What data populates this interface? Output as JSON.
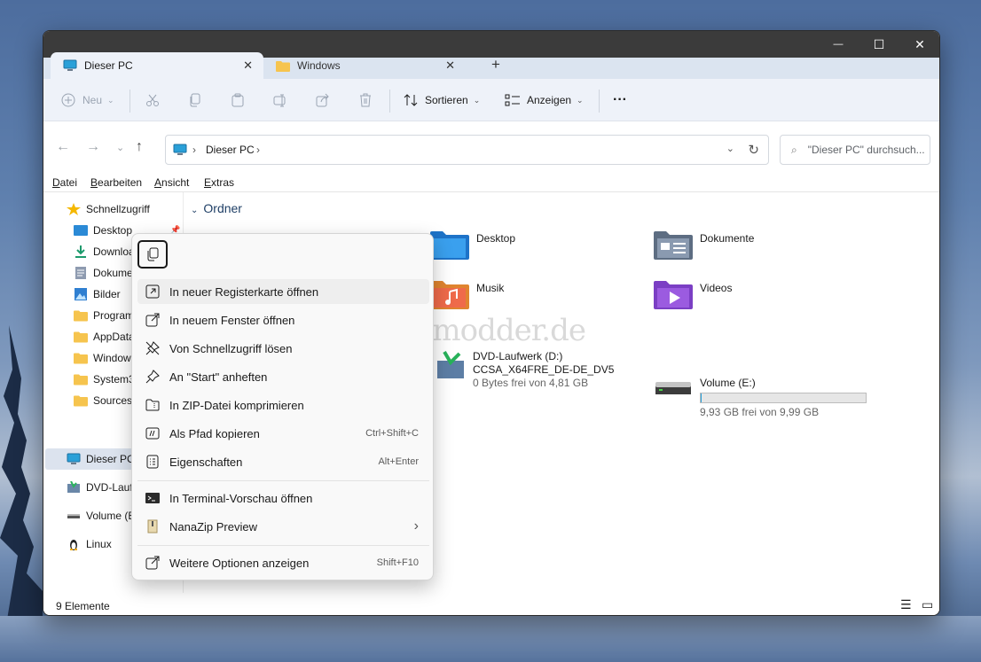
{
  "window": {
    "tabs": [
      {
        "label": "Dieser PC",
        "close": "✕"
      },
      {
        "label": "Windows",
        "close": "✕"
      }
    ],
    "new_tab": "+",
    "caption": {
      "minimize": "—",
      "maximize": "☐",
      "close": "✕"
    }
  },
  "toolbar": {
    "new_label": "Neu",
    "sort_label": "Sortieren",
    "view_label": "Anzeigen",
    "more_label": "···"
  },
  "navbar": {
    "breadcrumb": "Dieser PC",
    "search_placeholder": "\"Dieser PC\" durchsuch..."
  },
  "menubar": {
    "items": [
      {
        "accel": "D",
        "rest": "atei"
      },
      {
        "accel": "B",
        "rest": "earbeiten"
      },
      {
        "accel": "A",
        "rest": "nsicht"
      },
      {
        "accel": "E",
        "rest": "xtras"
      }
    ]
  },
  "sidebar": {
    "items": [
      {
        "label": "Schnellzugriff",
        "icon": "star-icon"
      },
      {
        "label": "Desktop",
        "icon": "desktop-folder-icon"
      },
      {
        "label": "Downloa",
        "icon": "download-icon"
      },
      {
        "label": "Dokume",
        "icon": "documents-icon"
      },
      {
        "label": "Bilder",
        "icon": "pictures-icon"
      },
      {
        "label": "Program",
        "icon": "folder-icon"
      },
      {
        "label": "AppData",
        "icon": "folder-icon"
      },
      {
        "label": "Window",
        "icon": "folder-icon"
      },
      {
        "label": "System3",
        "icon": "folder-icon"
      },
      {
        "label": "Sources",
        "icon": "folder-icon"
      },
      {
        "label": "Dieser PC",
        "icon": "pc-icon"
      },
      {
        "label": "DVD-Lauf",
        "icon": "dvd-icon"
      },
      {
        "label": "Volume (E",
        "icon": "drive-icon"
      },
      {
        "label": "Linux",
        "icon": "linux-icon"
      }
    ]
  },
  "content": {
    "section_title": "Ordner",
    "folders": [
      {
        "label": "Desktop"
      },
      {
        "label": "Dokumente"
      },
      {
        "label": "Musik"
      },
      {
        "label": "Videos"
      }
    ],
    "drives": [
      {
        "name": "DVD-Laufwerk (D:)",
        "line2": "CCSA_X64FRE_DE-DE_DV5",
        "free": "0 Bytes frei von 4,81 GB"
      },
      {
        "name": "Volume (E:)",
        "free": "9,93 GB frei von 9,99 GB",
        "used_fraction": 0.006
      }
    ]
  },
  "watermark": "Deskmodder.de",
  "status": {
    "count": "9 Elemente"
  },
  "context_menu": {
    "items": [
      {
        "label": "In neuer Registerkarte öffnen",
        "shortcut": "",
        "icon": "open-in-tab-icon"
      },
      {
        "label": "In neuem Fenster öffnen",
        "shortcut": "",
        "icon": "open-window-icon"
      },
      {
        "label": "Von Schnellzugriff lösen",
        "shortcut": "",
        "icon": "unpin-icon"
      },
      {
        "label": "An \"Start\" anheften",
        "shortcut": "",
        "icon": "pin-icon"
      },
      {
        "label": "In ZIP-Datei komprimieren",
        "shortcut": "",
        "icon": "zip-icon"
      },
      {
        "label": "Als Pfad kopieren",
        "shortcut": "Ctrl+Shift+C",
        "icon": "copy-path-icon"
      },
      {
        "label": "Eigenschaften",
        "shortcut": "Alt+Enter",
        "icon": "properties-icon"
      },
      {
        "label": "In Terminal-Vorschau öffnen",
        "shortcut": "",
        "icon": "terminal-icon"
      },
      {
        "label": "NanaZip Preview",
        "shortcut": "",
        "icon": "nanazip-icon"
      },
      {
        "label": "Weitere Optionen anzeigen",
        "shortcut": "Shift+F10",
        "icon": "more-options-icon"
      }
    ],
    "submenu_arrow": "›"
  },
  "colors": {
    "accent": "#0067c0",
    "selection": "#dce3ee",
    "folder": "#f6c44e"
  }
}
